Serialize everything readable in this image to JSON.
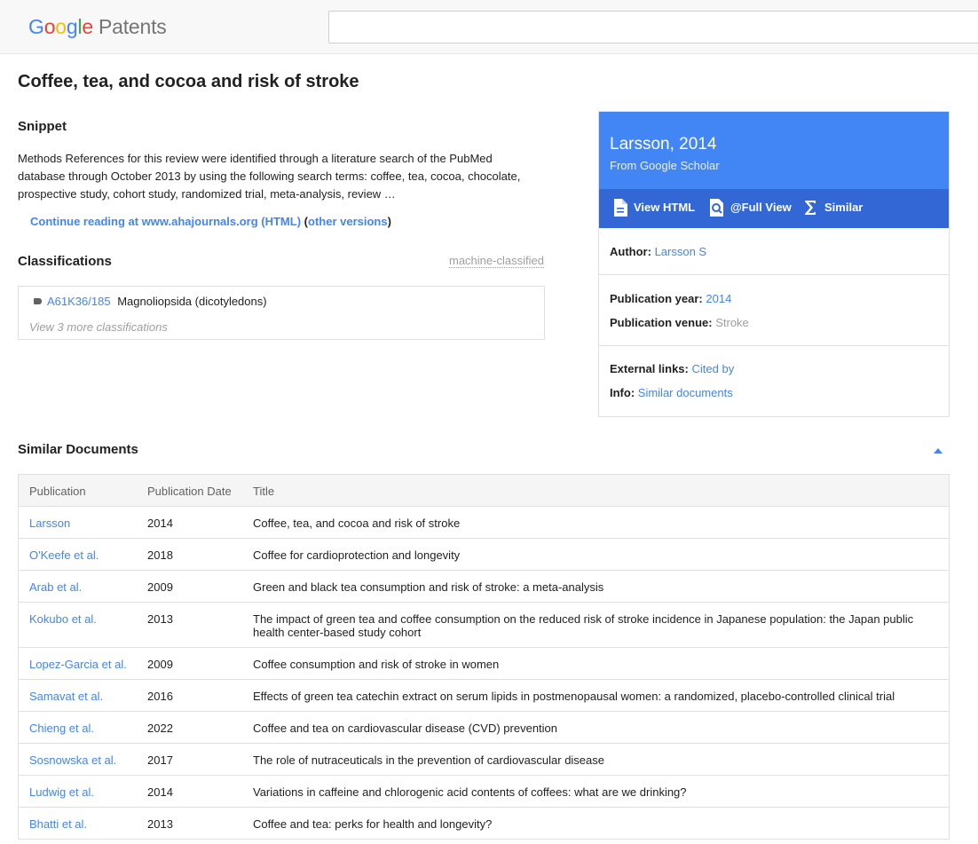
{
  "header": {
    "logo_letters": [
      "G",
      "o",
      "o",
      "g",
      "l",
      "e"
    ],
    "logo_product": "Patents",
    "search_value": ""
  },
  "page_title": "Coffee, tea, and cocoa and risk of stroke",
  "snippet": {
    "heading": "Snippet",
    "text": "Methods References for this review were identified through a literature search of the PubMed database through October 2013 by using the following search terms: coffee, tea, cocoa, chocolate, prospective study, cohort study, randomized trial, meta-analysis, review …",
    "continue_link": "Continue reading at www.ahajournals.org (HTML)",
    "paren_open": "(",
    "other_versions": "other versions",
    "paren_close": ")"
  },
  "classifications": {
    "heading": "Classifications",
    "machine_label": "machine-classified",
    "code": "A61K36/185",
    "description": "Magnoliopsida (dicotyledons)",
    "view_more": "View 3 more classifications"
  },
  "card": {
    "title": "Larsson, 2014",
    "subtitle": "From Google Scholar",
    "actions": {
      "view_html": "View HTML",
      "full_view": "@Full View",
      "similar": "Similar"
    },
    "author_label": "Author:",
    "author_value": "Larsson S",
    "year_label": "Publication year:",
    "year_value": "2014",
    "venue_label": "Publication venue:",
    "venue_value": "Stroke",
    "external_label": "External links:",
    "external_value": "Cited by",
    "info_label": "Info:",
    "info_value": "Similar documents"
  },
  "similar": {
    "heading": "Similar Documents",
    "columns": [
      "Publication",
      "Publication Date",
      "Title"
    ],
    "rows": [
      {
        "pub": "Larsson",
        "date": "2014",
        "title": "Coffee, tea, and cocoa and risk of stroke"
      },
      {
        "pub": "O'Keefe et al.",
        "date": "2018",
        "title": "Coffee for cardioprotection and longevity"
      },
      {
        "pub": "Arab et al.",
        "date": "2009",
        "title": "Green and black tea consumption and risk of stroke: a meta-analysis"
      },
      {
        "pub": "Kokubo et al.",
        "date": "2013",
        "title": "The impact of green tea and coffee consumption on the reduced risk of stroke incidence in Japanese population: the Japan public health center-based study cohort"
      },
      {
        "pub": "Lopez-Garcia et al.",
        "date": "2009",
        "title": "Coffee consumption and risk of stroke in women"
      },
      {
        "pub": "Samavat et al.",
        "date": "2016",
        "title": "Effects of green tea catechin extract on serum lipids in postmenopausal women: a randomized, placebo-controlled clinical trial"
      },
      {
        "pub": "Chieng et al.",
        "date": "2022",
        "title": "Coffee and tea on cardiovascular disease (CVD) prevention"
      },
      {
        "pub": "Sosnowska et al.",
        "date": "2017",
        "title": "The role of nutraceuticals in the prevention of cardiovascular disease"
      },
      {
        "pub": "Ludwig et al.",
        "date": "2014",
        "title": "Variations in caffeine and chlorogenic acid contents of coffees: what are we drinking?"
      },
      {
        "pub": "Bhatti et al.",
        "date": "2013",
        "title": "Coffee and tea: perks for health and longevity?"
      }
    ]
  },
  "colors": {
    "accent": "#4285f4",
    "card_header": "#4285f4",
    "card_actions": "#3367d6"
  }
}
